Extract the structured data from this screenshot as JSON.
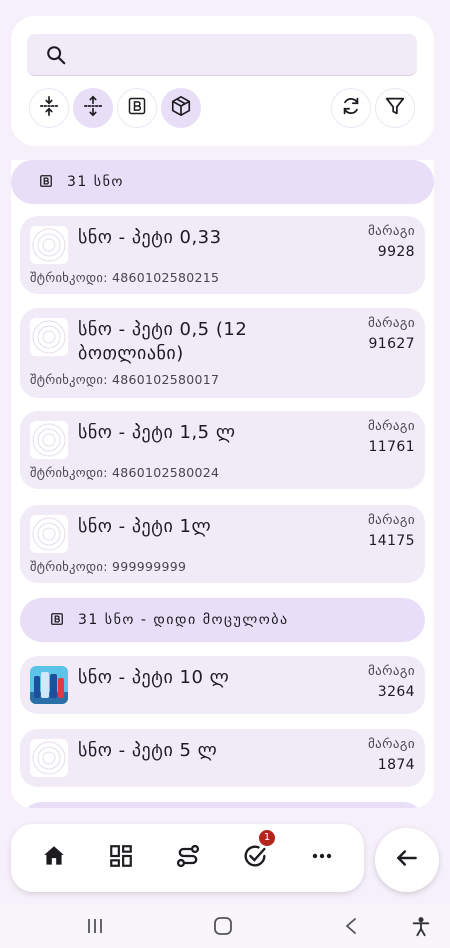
{
  "search": {
    "placeholder": "",
    "icon": "search-icon"
  },
  "toolbar": {
    "left_chips": [
      {
        "icon": "collapse-vertical-icon",
        "active": false
      },
      {
        "icon": "expand-vertical-icon",
        "active": true
      },
      {
        "icon": "barcode-box-icon",
        "active": false
      },
      {
        "icon": "package-icon",
        "active": true
      }
    ],
    "right_chips": [
      {
        "icon": "refresh-icon"
      },
      {
        "icon": "filter-icon"
      }
    ]
  },
  "groups": [
    {
      "label": "31 სნო"
    },
    {
      "label": "31 სნო - დიდი მოცულობა"
    }
  ],
  "items": [
    {
      "name": "სნო - პეტი 0,33",
      "stock_label": "მარაგი",
      "stock": "9928",
      "barcode": "შტრიხკოდი: 4860102580215"
    },
    {
      "name": "სნო - პეტი 0,5 (12 ბოთლიანი)",
      "stock_label": "მარაგი",
      "stock": "91627",
      "barcode": "შტრიხკოდი: 4860102580017"
    },
    {
      "name": "სნო - პეტი 1,5 ლ",
      "stock_label": "მარაგი",
      "stock": "11761",
      "barcode": "შტრიხკოდი: 4860102580024"
    },
    {
      "name": "სნო - პეტი 1ლ",
      "stock_label": "მარაგი",
      "stock": "14175",
      "barcode": "შტრიხკოდი: 999999999"
    },
    {
      "name": "სნო - პეტი 10 ლ",
      "stock_label": "მარაგი",
      "stock": "3264"
    },
    {
      "name": "სნო - პეტი 5 ლ",
      "stock_label": "მარაგი",
      "stock": "1874"
    }
  ],
  "bottom_nav": {
    "items": [
      {
        "icon": "home-icon"
      },
      {
        "icon": "grid-icon"
      },
      {
        "icon": "route-icon"
      },
      {
        "icon": "task-check-icon",
        "badge": "1"
      },
      {
        "icon": "more-icon"
      }
    ],
    "back": {
      "icon": "back-arrow-icon"
    }
  },
  "system_nav": {
    "icons": [
      "recents-icon",
      "home-circle-icon",
      "back-chevron-icon",
      "accessibility-icon"
    ]
  },
  "colors": {
    "accent": "#e8def8",
    "surface": "#f1ebf8",
    "badge": "#b3261e"
  }
}
